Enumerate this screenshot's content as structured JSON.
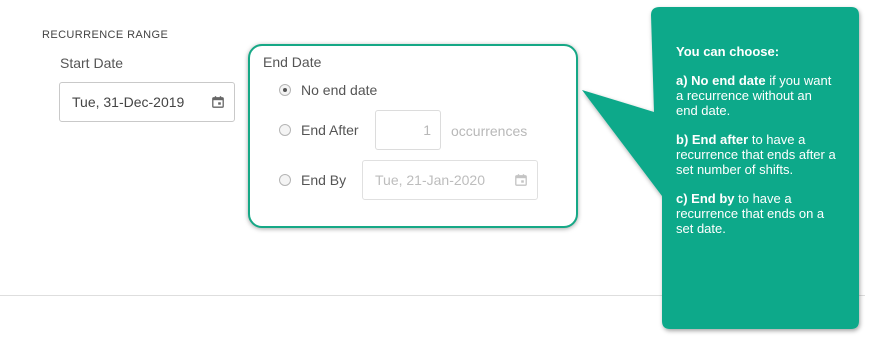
{
  "section": {
    "title": "RECURRENCE RANGE"
  },
  "start": {
    "label": "Start Date",
    "value": "Tue, 31-Dec-2019"
  },
  "end": {
    "label": "End Date",
    "options": [
      {
        "label": "No end date",
        "checked": true
      },
      {
        "label": "End After",
        "checked": false
      },
      {
        "label": "End By",
        "checked": false
      }
    ],
    "occurrences_value": "1",
    "occurrences_label": "occurrences",
    "end_by_value": "Tue, 21-Jan-2020"
  },
  "tooltip": {
    "heading": "You can choose:",
    "items": [
      {
        "lead": "a) No end date",
        "rest": " if you want a recurrence without an end date."
      },
      {
        "lead": "b) End after",
        "rest": " to have a recurrence that ends after a set number of shifts."
      },
      {
        "lead": "c) End by",
        "rest": " to have a recurrence that ends on a set date."
      }
    ]
  },
  "colors": {
    "accent": "#16a886",
    "tooltip_bg": "#0ca98a"
  },
  "icons": [
    "calendar-icon",
    "radio-button"
  ]
}
